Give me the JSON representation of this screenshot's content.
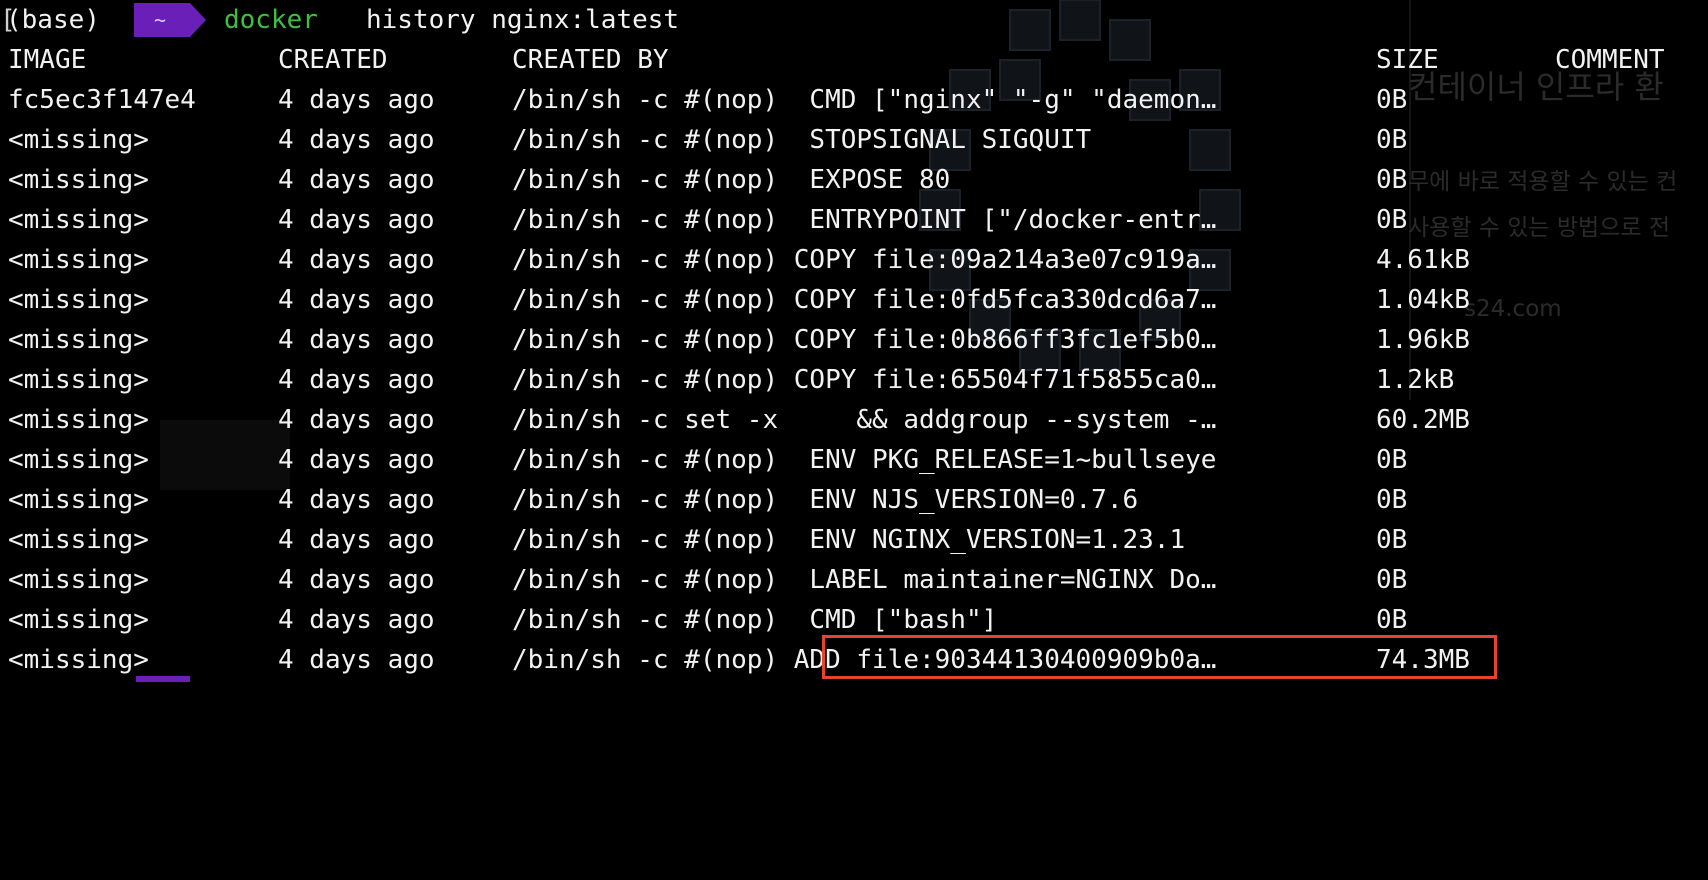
{
  "prompt": {
    "bracket": "[",
    "env": "(base)",
    "dir": "~",
    "command": "docker",
    "args": "history nginx:latest"
  },
  "table": {
    "headers": {
      "image": "IMAGE",
      "created": "CREATED",
      "created_by": "CREATED BY",
      "size": "SIZE",
      "comment": "COMMENT"
    },
    "rows": [
      {
        "image": "fc5ec3f147e4",
        "created": "4 days ago",
        "created_by": "/bin/sh -c #(nop)  CMD [\"nginx\" \"-g\" \"daemon…",
        "size": "0B"
      },
      {
        "image": "<missing>",
        "created": "4 days ago",
        "created_by": "/bin/sh -c #(nop)  STOPSIGNAL SIGQUIT",
        "size": "0B"
      },
      {
        "image": "<missing>",
        "created": "4 days ago",
        "created_by": "/bin/sh -c #(nop)  EXPOSE 80",
        "size": "0B"
      },
      {
        "image": "<missing>",
        "created": "4 days ago",
        "created_by": "/bin/sh -c #(nop)  ENTRYPOINT [\"/docker-entr…",
        "size": "0B"
      },
      {
        "image": "<missing>",
        "created": "4 days ago",
        "created_by": "/bin/sh -c #(nop) COPY file:09a214a3e07c919a…",
        "size": "4.61kB"
      },
      {
        "image": "<missing>",
        "created": "4 days ago",
        "created_by": "/bin/sh -c #(nop) COPY file:0fd5fca330dcd6a7…",
        "size": "1.04kB"
      },
      {
        "image": "<missing>",
        "created": "4 days ago",
        "created_by": "/bin/sh -c #(nop) COPY file:0b866ff3fc1ef5b0…",
        "size": "1.96kB"
      },
      {
        "image": "<missing>",
        "created": "4 days ago",
        "created_by": "/bin/sh -c #(nop) COPY file:65504f71f5855ca0…",
        "size": "1.2kB"
      },
      {
        "image": "<missing>",
        "created": "4 days ago",
        "created_by": "/bin/sh -c set -x     && addgroup --system -…",
        "size": "60.2MB"
      },
      {
        "image": "<missing>",
        "created": "4 days ago",
        "created_by": "/bin/sh -c #(nop)  ENV PKG_RELEASE=1~bullseye",
        "size": "0B"
      },
      {
        "image": "<missing>",
        "created": "4 days ago",
        "created_by": "/bin/sh -c #(nop)  ENV NJS_VERSION=0.7.6",
        "size": "0B"
      },
      {
        "image": "<missing>",
        "created": "4 days ago",
        "created_by": "/bin/sh -c #(nop)  ENV NGINX_VERSION=1.23.1",
        "size": "0B"
      },
      {
        "image": "<missing>",
        "created": "4 days ago",
        "created_by": "/bin/sh -c #(nop)  LABEL maintainer=NGINX Do…",
        "size": "0B"
      },
      {
        "image": "<missing>",
        "created": "4 days ago",
        "created_by": "/bin/sh -c #(nop)  CMD [\"bash\"]",
        "size": "0B"
      },
      {
        "image": "<missing>",
        "created": "4 days ago",
        "created_by": "/bin/sh -c #(nop) ADD file:90344130400909b0a…",
        "size": "74.3MB"
      }
    ]
  },
  "background": {
    "heading": "컨테이너 인프라 환",
    "line1": "무에 바로 적용할 수 있는 컨",
    "line2": "사용할 수 있는 방법으로 전",
    "url": "s24.com"
  },
  "colors": {
    "background": "#000000",
    "text": "#f2f2f2",
    "command": "#3fbf3f",
    "prompt_badge": "#6a1fb8",
    "highlight_border": "#e5462b"
  }
}
